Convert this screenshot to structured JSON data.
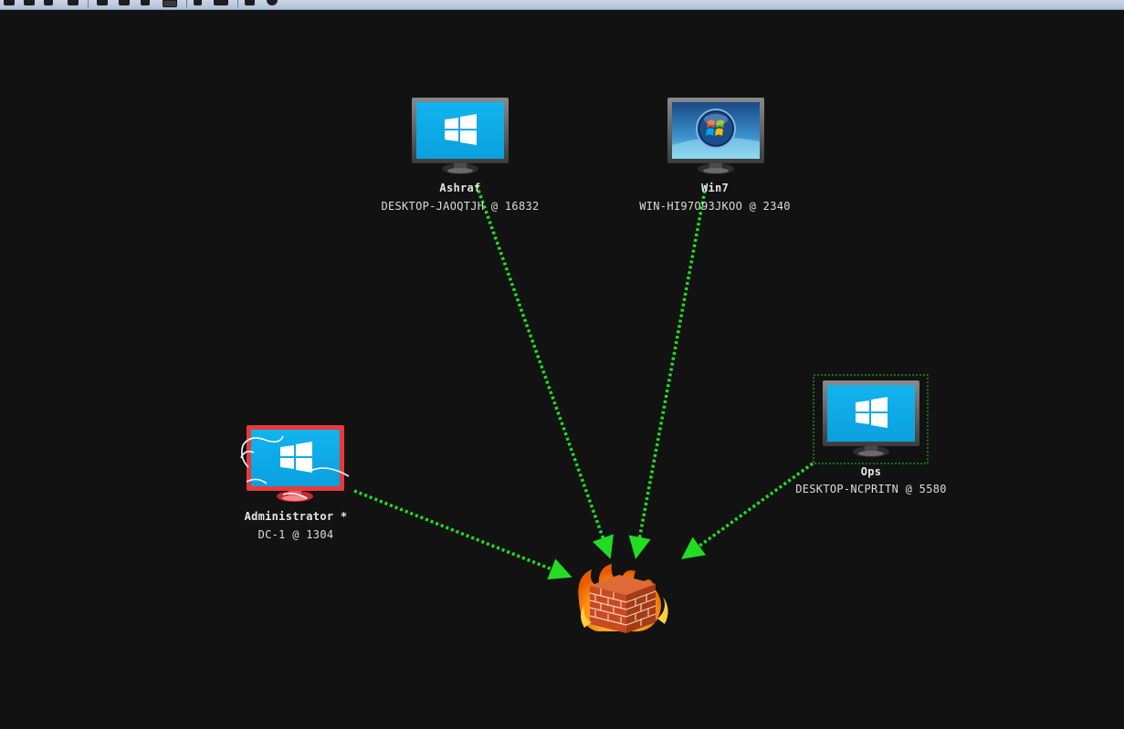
{
  "toolbar": {
    "buttons": [
      "connect-icon",
      "disconnect-icon",
      "edit-icon",
      "save-icon",
      "settings-icon",
      "key-icon",
      "credentials-icon",
      "screenshot-icon",
      "link-icon",
      "console-icon",
      "log-icon",
      "cube-icon"
    ]
  },
  "graph": {
    "edge_color": "#22dd22",
    "nodes": [
      {
        "id": "ashraf",
        "title": "Ashraf",
        "subtitle": "DESKTOP-JAOQTJH @ 16832",
        "os": "windows-10",
        "selected": false,
        "elevated": false
      },
      {
        "id": "win7",
        "title": "Win7",
        "subtitle": "WIN-HI97O93JKOO @ 2340",
        "os": "windows-7",
        "selected": false,
        "elevated": false
      },
      {
        "id": "ops",
        "title": "Ops",
        "subtitle": "DESKTOP-NCPRITN @ 5580",
        "os": "windows-10",
        "selected": true,
        "elevated": false
      },
      {
        "id": "administrator",
        "title": "Administrator *",
        "subtitle": "DC-1 @ 1304",
        "os": "windows-10",
        "selected": false,
        "elevated": true
      }
    ],
    "firewall": {
      "name": "firewall-icon"
    }
  }
}
